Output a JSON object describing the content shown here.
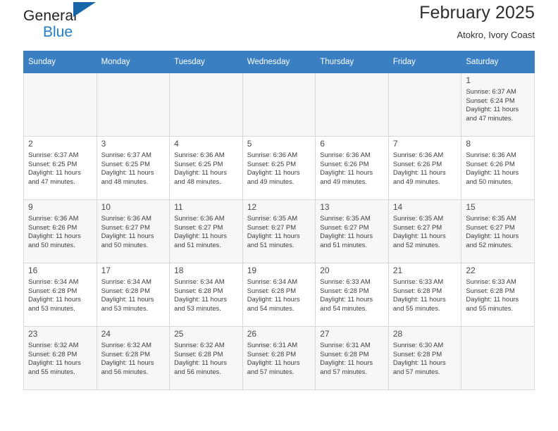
{
  "brand": {
    "name_part1": "General",
    "name_part2": "Blue",
    "triangle_icon": "triangle-icon",
    "color_primary": "#1f7fc6",
    "color_triangle": "#1565a8"
  },
  "header": {
    "title": "February 2025",
    "subtitle": "Atokro, Ivory Coast"
  },
  "calendar": {
    "header_bg": "#3a7fc1",
    "weekdays": [
      "Sunday",
      "Monday",
      "Tuesday",
      "Wednesday",
      "Thursday",
      "Friday",
      "Saturday"
    ],
    "labels": {
      "sunrise": "Sunrise:",
      "sunset": "Sunset:",
      "daylight": "Daylight:"
    },
    "weeks": [
      [
        {
          "empty": true
        },
        {
          "empty": true
        },
        {
          "empty": true
        },
        {
          "empty": true
        },
        {
          "empty": true
        },
        {
          "empty": true
        },
        {
          "day": "1",
          "sunrise": "Sunrise: 6:37 AM",
          "sunset": "Sunset: 6:24 PM",
          "daylight_line1": "Daylight: 11 hours",
          "daylight_line2": "and 47 minutes."
        }
      ],
      [
        {
          "day": "2",
          "sunrise": "Sunrise: 6:37 AM",
          "sunset": "Sunset: 6:25 PM",
          "daylight_line1": "Daylight: 11 hours",
          "daylight_line2": "and 47 minutes."
        },
        {
          "day": "3",
          "sunrise": "Sunrise: 6:37 AM",
          "sunset": "Sunset: 6:25 PM",
          "daylight_line1": "Daylight: 11 hours",
          "daylight_line2": "and 48 minutes."
        },
        {
          "day": "4",
          "sunrise": "Sunrise: 6:36 AM",
          "sunset": "Sunset: 6:25 PM",
          "daylight_line1": "Daylight: 11 hours",
          "daylight_line2": "and 48 minutes."
        },
        {
          "day": "5",
          "sunrise": "Sunrise: 6:36 AM",
          "sunset": "Sunset: 6:25 PM",
          "daylight_line1": "Daylight: 11 hours",
          "daylight_line2": "and 49 minutes."
        },
        {
          "day": "6",
          "sunrise": "Sunrise: 6:36 AM",
          "sunset": "Sunset: 6:26 PM",
          "daylight_line1": "Daylight: 11 hours",
          "daylight_line2": "and 49 minutes."
        },
        {
          "day": "7",
          "sunrise": "Sunrise: 6:36 AM",
          "sunset": "Sunset: 6:26 PM",
          "daylight_line1": "Daylight: 11 hours",
          "daylight_line2": "and 49 minutes."
        },
        {
          "day": "8",
          "sunrise": "Sunrise: 6:36 AM",
          "sunset": "Sunset: 6:26 PM",
          "daylight_line1": "Daylight: 11 hours",
          "daylight_line2": "and 50 minutes."
        }
      ],
      [
        {
          "day": "9",
          "sunrise": "Sunrise: 6:36 AM",
          "sunset": "Sunset: 6:26 PM",
          "daylight_line1": "Daylight: 11 hours",
          "daylight_line2": "and 50 minutes."
        },
        {
          "day": "10",
          "sunrise": "Sunrise: 6:36 AM",
          "sunset": "Sunset: 6:27 PM",
          "daylight_line1": "Daylight: 11 hours",
          "daylight_line2": "and 50 minutes."
        },
        {
          "day": "11",
          "sunrise": "Sunrise: 6:36 AM",
          "sunset": "Sunset: 6:27 PM",
          "daylight_line1": "Daylight: 11 hours",
          "daylight_line2": "and 51 minutes."
        },
        {
          "day": "12",
          "sunrise": "Sunrise: 6:35 AM",
          "sunset": "Sunset: 6:27 PM",
          "daylight_line1": "Daylight: 11 hours",
          "daylight_line2": "and 51 minutes."
        },
        {
          "day": "13",
          "sunrise": "Sunrise: 6:35 AM",
          "sunset": "Sunset: 6:27 PM",
          "daylight_line1": "Daylight: 11 hours",
          "daylight_line2": "and 51 minutes."
        },
        {
          "day": "14",
          "sunrise": "Sunrise: 6:35 AM",
          "sunset": "Sunset: 6:27 PM",
          "daylight_line1": "Daylight: 11 hours",
          "daylight_line2": "and 52 minutes."
        },
        {
          "day": "15",
          "sunrise": "Sunrise: 6:35 AM",
          "sunset": "Sunset: 6:27 PM",
          "daylight_line1": "Daylight: 11 hours",
          "daylight_line2": "and 52 minutes."
        }
      ],
      [
        {
          "day": "16",
          "sunrise": "Sunrise: 6:34 AM",
          "sunset": "Sunset: 6:28 PM",
          "daylight_line1": "Daylight: 11 hours",
          "daylight_line2": "and 53 minutes."
        },
        {
          "day": "17",
          "sunrise": "Sunrise: 6:34 AM",
          "sunset": "Sunset: 6:28 PM",
          "daylight_line1": "Daylight: 11 hours",
          "daylight_line2": "and 53 minutes."
        },
        {
          "day": "18",
          "sunrise": "Sunrise: 6:34 AM",
          "sunset": "Sunset: 6:28 PM",
          "daylight_line1": "Daylight: 11 hours",
          "daylight_line2": "and 53 minutes."
        },
        {
          "day": "19",
          "sunrise": "Sunrise: 6:34 AM",
          "sunset": "Sunset: 6:28 PM",
          "daylight_line1": "Daylight: 11 hours",
          "daylight_line2": "and 54 minutes."
        },
        {
          "day": "20",
          "sunrise": "Sunrise: 6:33 AM",
          "sunset": "Sunset: 6:28 PM",
          "daylight_line1": "Daylight: 11 hours",
          "daylight_line2": "and 54 minutes."
        },
        {
          "day": "21",
          "sunrise": "Sunrise: 6:33 AM",
          "sunset": "Sunset: 6:28 PM",
          "daylight_line1": "Daylight: 11 hours",
          "daylight_line2": "and 55 minutes."
        },
        {
          "day": "22",
          "sunrise": "Sunrise: 6:33 AM",
          "sunset": "Sunset: 6:28 PM",
          "daylight_line1": "Daylight: 11 hours",
          "daylight_line2": "and 55 minutes."
        }
      ],
      [
        {
          "day": "23",
          "sunrise": "Sunrise: 6:32 AM",
          "sunset": "Sunset: 6:28 PM",
          "daylight_line1": "Daylight: 11 hours",
          "daylight_line2": "and 55 minutes."
        },
        {
          "day": "24",
          "sunrise": "Sunrise: 6:32 AM",
          "sunset": "Sunset: 6:28 PM",
          "daylight_line1": "Daylight: 11 hours",
          "daylight_line2": "and 56 minutes."
        },
        {
          "day": "25",
          "sunrise": "Sunrise: 6:32 AM",
          "sunset": "Sunset: 6:28 PM",
          "daylight_line1": "Daylight: 11 hours",
          "daylight_line2": "and 56 minutes."
        },
        {
          "day": "26",
          "sunrise": "Sunrise: 6:31 AM",
          "sunset": "Sunset: 6:28 PM",
          "daylight_line1": "Daylight: 11 hours",
          "daylight_line2": "and 57 minutes."
        },
        {
          "day": "27",
          "sunrise": "Sunrise: 6:31 AM",
          "sunset": "Sunset: 6:28 PM",
          "daylight_line1": "Daylight: 11 hours",
          "daylight_line2": "and 57 minutes."
        },
        {
          "day": "28",
          "sunrise": "Sunrise: 6:30 AM",
          "sunset": "Sunset: 6:28 PM",
          "daylight_line1": "Daylight: 11 hours",
          "daylight_line2": "and 57 minutes."
        },
        {
          "empty": true
        }
      ]
    ]
  }
}
